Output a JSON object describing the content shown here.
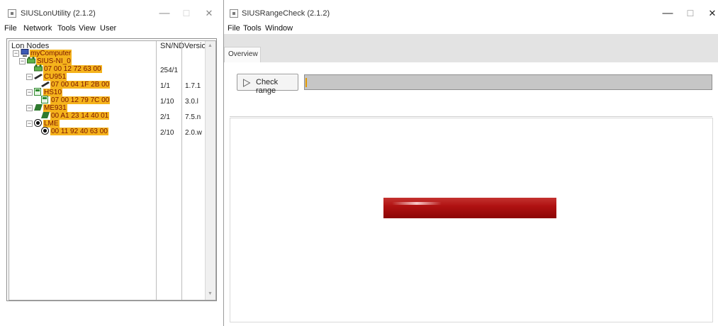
{
  "left_window": {
    "title": "SIUSLonUtility (2.1.2)",
    "controls": {
      "minimize": "—",
      "maximize": "☐",
      "close": "✕"
    },
    "menu": [
      "File",
      "Network",
      "Tools",
      "View",
      "User"
    ],
    "tree": {
      "columns": [
        "Lon Nodes",
        "SN/ND",
        "Version"
      ],
      "rows": [
        {
          "label": "myComputer",
          "sn_nd": "",
          "version": "",
          "icon": "computer-icon"
        },
        {
          "label": "SIUS-NI_0",
          "sn_nd": "",
          "version": "",
          "icon": "network-interface-icon"
        },
        {
          "label": "07 00 12 72 63 00",
          "sn_nd": "254/1",
          "version": "",
          "icon": "network-interface-icon"
        },
        {
          "label": "CU951",
          "sn_nd": "",
          "version": "",
          "icon": "control-unit-icon"
        },
        {
          "label": "07 00 04 1F 2B 00",
          "sn_nd": "1/1",
          "version": "1.7.1",
          "icon": "control-unit-icon"
        },
        {
          "label": "HS10",
          "sn_nd": "",
          "version": "",
          "icon": "hs10-device-icon"
        },
        {
          "label": "07 00 12 79 7C 00",
          "sn_nd": "1/10",
          "version": "3.0.l",
          "icon": "hs10-device-icon"
        },
        {
          "label": "ME931",
          "sn_nd": "",
          "version": "",
          "icon": "me931-device-icon"
        },
        {
          "label": "00 A1 23 14 40 01",
          "sn_nd": "2/1",
          "version": "7.5.n",
          "icon": "me931-device-icon"
        },
        {
          "label": "LME",
          "sn_nd": "",
          "version": "",
          "icon": "target-icon"
        },
        {
          "label": "00 11 92 40 63 00",
          "sn_nd": "2/10",
          "version": "2.0.w",
          "icon": "target-icon"
        }
      ]
    }
  },
  "right_window": {
    "title": "SIUSRangeCheck (2.1.2)",
    "controls": {
      "minimize": "—",
      "maximize": "☐",
      "close": "✕"
    },
    "menu": [
      "File",
      "Tools",
      "Window"
    ],
    "tabs": [
      {
        "label": "Overview",
        "active": true
      }
    ],
    "check_button": {
      "label": "Check range",
      "icon": "play-icon"
    },
    "progress": {
      "value": 0.0
    },
    "indicator": {
      "color": "#b01212"
    }
  },
  "colors": {
    "node_highlight": "#f5b31c",
    "node_text": "#7a1500",
    "progress_accent": "#e39a00"
  }
}
